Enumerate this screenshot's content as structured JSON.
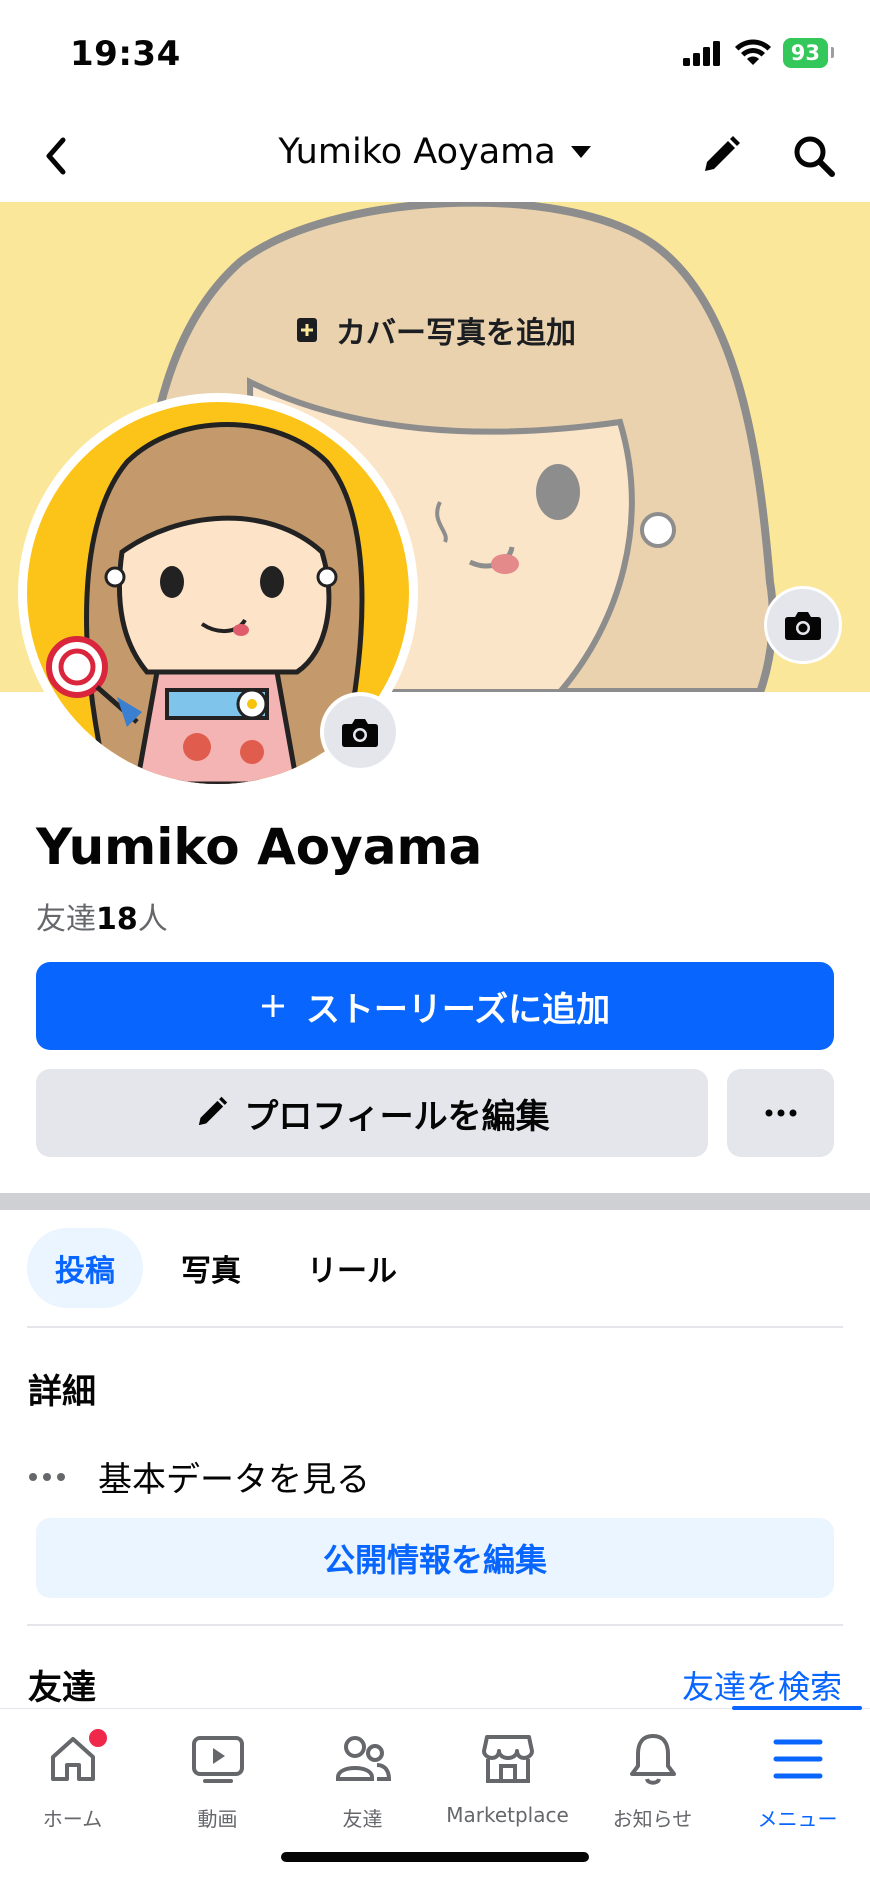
{
  "status_bar": {
    "time": "19:34",
    "battery": "93"
  },
  "nav": {
    "title": "Yumiko Aoyama",
    "icons": [
      "back-icon",
      "caret-down-icon",
      "pencil-icon",
      "search-icon"
    ]
  },
  "cover": {
    "add_cover_label": "カバー写真を追加",
    "background_color": "#fbe79a"
  },
  "profile": {
    "name": "Yumiko Aoyama",
    "friends_prefix": "友達",
    "friends_count": "18",
    "friends_suffix": "人",
    "avatar_color": "#fcc419"
  },
  "actions": {
    "add_story_label": "ストーリーズに追加",
    "edit_profile_label": "プロフィールを編集"
  },
  "tabs": [
    {
      "label": "投稿",
      "active": true
    },
    {
      "label": "写真",
      "active": false
    },
    {
      "label": "リール",
      "active": false
    }
  ],
  "details": {
    "title": "詳細",
    "basic_data_label": "基本データを見る",
    "edit_public_label": "公開情報を編集"
  },
  "friends_section": {
    "title": "友達",
    "find_friends_label": "友達を検索"
  },
  "bottom_nav": [
    {
      "label": "ホーム",
      "icon": "home-icon",
      "badge": true
    },
    {
      "label": "動画",
      "icon": "video-icon"
    },
    {
      "label": "友達",
      "icon": "friends-icon"
    },
    {
      "label": "Marketplace",
      "icon": "marketplace-icon"
    },
    {
      "label": "お知らせ",
      "icon": "bell-icon"
    },
    {
      "label": "メニュー",
      "icon": "menu-icon",
      "active": true
    }
  ],
  "colors": {
    "accent": "#0866ff",
    "secondary_button": "#e4e6eb",
    "notification_badge": "#f02849"
  }
}
